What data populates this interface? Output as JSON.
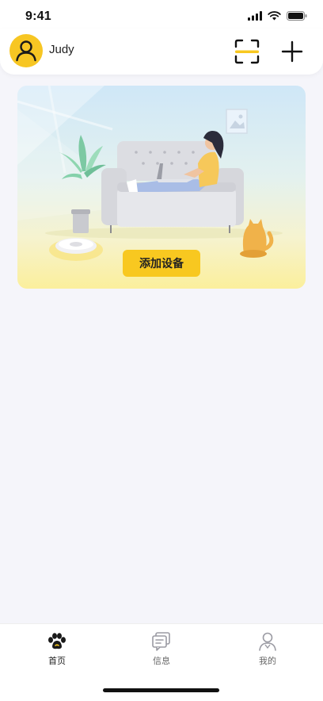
{
  "status_bar": {
    "time": "9:41"
  },
  "header": {
    "user_name": "Judy"
  },
  "banner": {
    "button_label": "添加设备"
  },
  "tabs": [
    {
      "label": "首页",
      "icon": "paw-icon",
      "active": true
    },
    {
      "label": "信息",
      "icon": "message-icon",
      "active": false
    },
    {
      "label": "我的",
      "icon": "profile-icon",
      "active": false
    }
  ],
  "colors": {
    "accent": "#f8c820",
    "background": "#f5f5fa"
  }
}
